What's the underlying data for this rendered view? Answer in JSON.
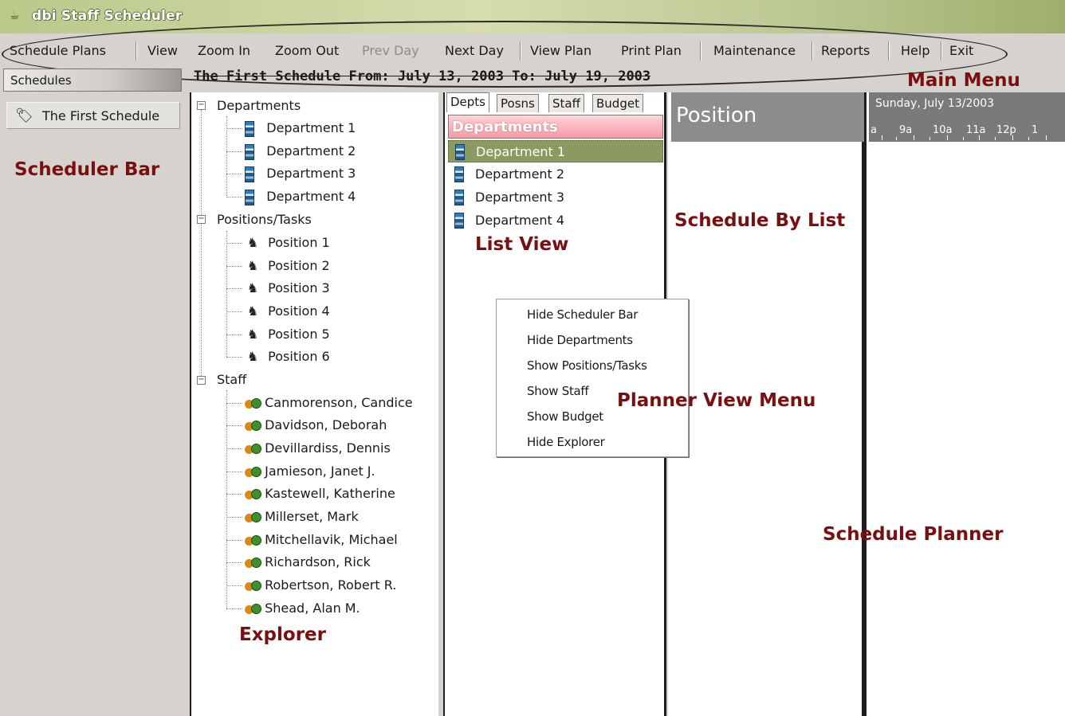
{
  "window": {
    "title": "dbi Staff Scheduler",
    "app_icon": "scheduler-app-icon"
  },
  "menu": {
    "items": [
      {
        "label": "Schedule Plans",
        "enabled": true
      },
      {
        "label": "View",
        "enabled": true
      },
      {
        "label": "Zoom In",
        "enabled": true
      },
      {
        "label": "Zoom Out",
        "enabled": true
      },
      {
        "label": "Prev Day",
        "enabled": false
      },
      {
        "label": "Next Day",
        "enabled": true
      },
      {
        "label": "View Plan",
        "enabled": true
      },
      {
        "label": "Print Plan",
        "enabled": true
      },
      {
        "label": "Maintenance",
        "enabled": true
      },
      {
        "label": "Reports",
        "enabled": true
      },
      {
        "label": "Help",
        "enabled": true
      },
      {
        "label": "Exit",
        "enabled": true
      }
    ]
  },
  "scheduler_bar": {
    "header": "Schedules",
    "items": [
      {
        "label": "The First Schedule",
        "icon": "schedule-tag-icon"
      }
    ]
  },
  "schedule_title": "The First Schedule   From: July 13, 2003 To: July 19, 2003",
  "explorer": {
    "groups": [
      {
        "label": "Departments",
        "icon": "department-icon",
        "items": [
          "Department 1",
          "Department 2",
          "Department 3",
          "Department 4"
        ]
      },
      {
        "label": "Positions/Tasks",
        "icon": "position-icon",
        "items": [
          "Position 1",
          "Position 2",
          "Position 3",
          "Position 4",
          "Position 5",
          "Position 6"
        ]
      },
      {
        "label": "Staff",
        "icon": "staff-icon",
        "items": [
          "Canmorenson, Candice",
          "Davidson, Deborah",
          "Devillardiss, Dennis",
          "Jamieson, Janet J.",
          "Kastewell, Katherine",
          "Millerset, Mark",
          "Mitchellavik, Michael",
          "Richardson, Rick",
          "Robertson, Robert R.",
          "Shead, Alan M."
        ]
      }
    ]
  },
  "list_view": {
    "tabs": [
      "Depts",
      "Posns",
      "Staff",
      "Budget"
    ],
    "active_tab": "Depts",
    "header": "Departments",
    "rows": [
      "Department 1",
      "Department 2",
      "Department 3",
      "Department 4"
    ],
    "selected_row": "Department 1",
    "header_color": "#f49aa5",
    "selected_color": "#8a9a60"
  },
  "by_list": {
    "header": "Position"
  },
  "planner": {
    "date": "Sunday, July 13/2003",
    "hours": [
      "a",
      "9a",
      "10a",
      "11a",
      "12p",
      "1"
    ]
  },
  "context_menu": {
    "items": [
      "Hide Scheduler Bar",
      "Hide Departments",
      "Show Positions/Tasks",
      "Show Staff",
      "Show Budget",
      "Hide Explorer"
    ]
  },
  "annotations": {
    "main_menu": "Main Menu",
    "scheduler_bar": "Scheduler Bar",
    "list_view": "List View",
    "schedule_by_list": "Schedule By List",
    "planner_view_menu": "Planner View Menu",
    "schedule_planner": "Schedule Planner",
    "explorer": "Explorer",
    "color": "#7a0f0f"
  }
}
